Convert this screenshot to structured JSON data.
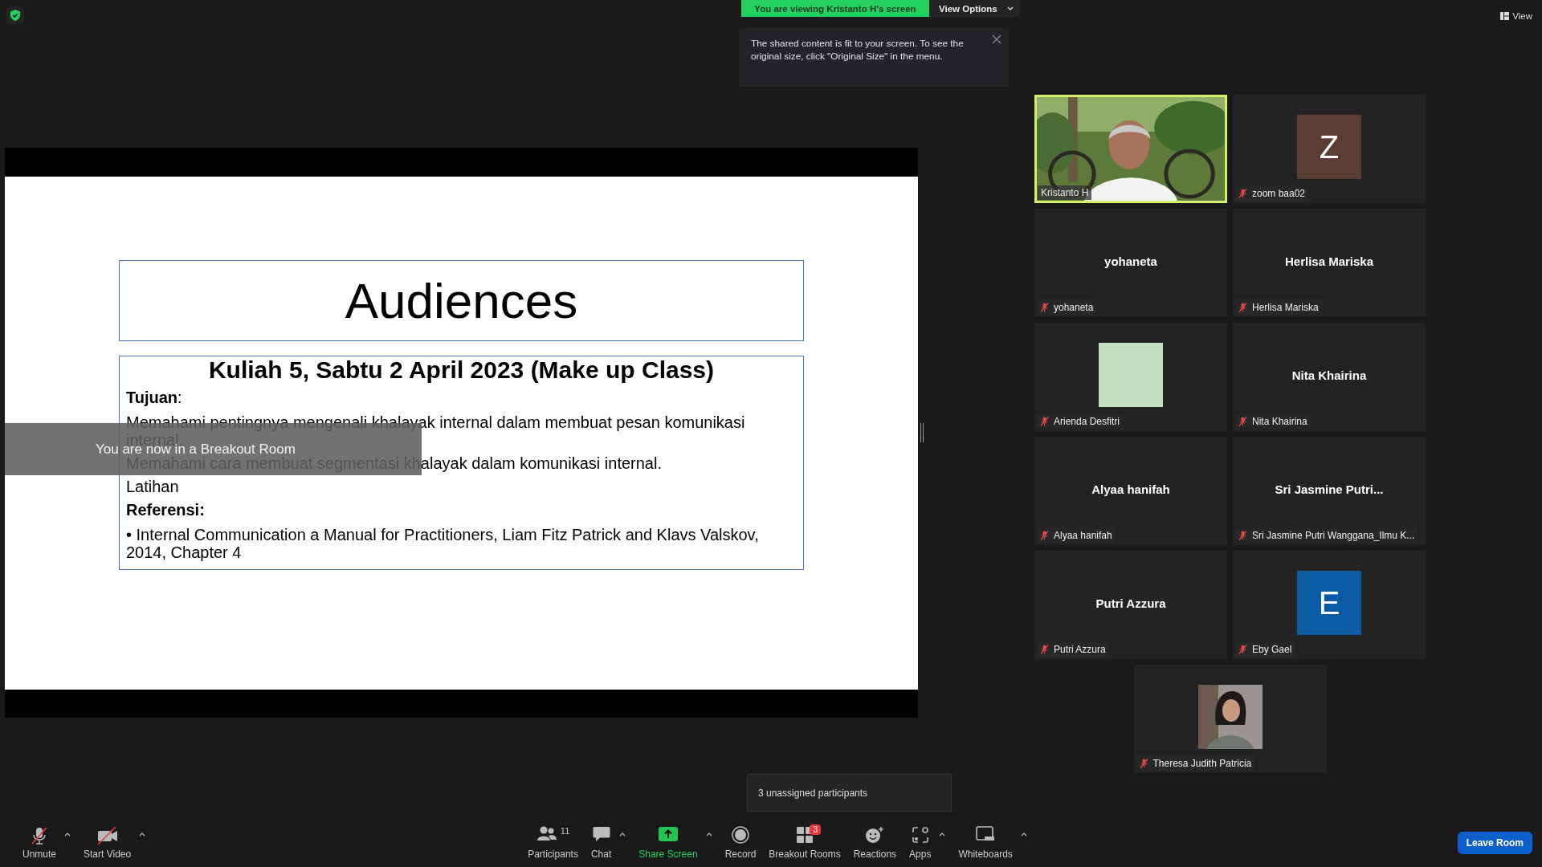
{
  "share_banner": {
    "text": "You are viewing Kristanto H's screen",
    "view_options": "View Options"
  },
  "tooltip": {
    "text": "The shared content is fit to your screen. To see the original size, click \"Original Size\" in the menu."
  },
  "view_button": "View",
  "slide": {
    "title": "Audiences",
    "heading": "Kuliah 5, Sabtu 2 April 2023 (Make up Class)",
    "lines": [
      {
        "kind": "label",
        "text": "**Tujuan**:"
      },
      {
        "kind": "text",
        "text": "Memahami pentingnya mengenali khalayak internal dalam membuat pesan komunikasi internal."
      },
      {
        "kind": "text",
        "text": "Memahami cara membuat segmentasi khalayak dalam komunikasi internal."
      },
      {
        "kind": "text",
        "text": "Latihan"
      },
      {
        "kind": "label",
        "text": "**Referensi:**"
      },
      {
        "kind": "text",
        "text": "• Internal Communication a Manual for Practitioners, Liam Fitz Patrick and Klavs   Valskov, 2014, Chapter 4"
      }
    ]
  },
  "breakout_notice": "You are now in a Breakout Room",
  "tiles": [
    {
      "kind": "video",
      "name": "Kristanto H",
      "muted": false,
      "active_speaker": true
    },
    {
      "kind": "avatar",
      "initial": "Z",
      "color": "#5b3d33",
      "name": "zoom baa02",
      "muted": true,
      "active_speaker": false
    },
    {
      "kind": "name",
      "display": "yohaneta",
      "name": "yohaneta",
      "muted": true,
      "active_speaker": false
    },
    {
      "kind": "name",
      "display": "Herlisa Mariska",
      "name": "Herlisa Mariska",
      "muted": true,
      "active_speaker": false
    },
    {
      "kind": "avatar",
      "color": "#c1e1c1",
      "name": "Arienda Desfitri",
      "muted": true,
      "active_speaker": false
    },
    {
      "kind": "name",
      "display": "Nita Khairina",
      "name": "Nita Khairina",
      "muted": true,
      "active_speaker": false
    },
    {
      "kind": "name",
      "display": "Alyaa hanifah",
      "name": "Alyaa hanifah",
      "muted": true,
      "active_speaker": false
    },
    {
      "kind": "name",
      "display": "Sri Jasmine Putri...",
      "name": "Sri Jasmine Putri Wanggana_Ilmu K...",
      "muted": true,
      "active_speaker": false
    },
    {
      "kind": "name",
      "display": "Putri Azzura",
      "name": "Putri Azzura",
      "muted": true,
      "active_speaker": false
    },
    {
      "kind": "avatar",
      "initial": "E",
      "color": "#0b5aa6",
      "name": "Eby Gael",
      "muted": true,
      "active_speaker": false
    },
    {
      "name": "Theresa Judith Patricia",
      "muted": true,
      "active_speaker": false
    }
  ],
  "unassigned_popup": "3 unassigned participants",
  "toolbar_left": [
    {
      "kind": "unmute",
      "label": "Unmute",
      "has_menu": true
    },
    {
      "kind": "video",
      "label": "Start Video",
      "has_menu": true
    }
  ],
  "toolbar_center": [
    {
      "kind": "participants",
      "label": "Participants",
      "count": "11",
      "has_menu": false,
      "highlighted": false
    },
    {
      "kind": "chat",
      "label": "Chat",
      "has_menu": true,
      "highlighted": false
    },
    {
      "kind": "share",
      "label": "Share Screen",
      "has_menu": true,
      "highlighted": true
    },
    {
      "kind": "record",
      "label": "Record",
      "has_menu": false,
      "highlighted": false
    },
    {
      "kind": "breakout",
      "label": "Breakout Rooms",
      "badge": "3",
      "has_menu": false,
      "highlighted": false
    },
    {
      "kind": "reactions",
      "label": "Reactions",
      "has_menu": false,
      "highlighted": false
    },
    {
      "kind": "apps",
      "label": "Apps",
      "has_menu": true,
      "highlighted": false
    },
    {
      "kind": "whiteboards",
      "label": "Whiteboards",
      "has_menu": true,
      "highlighted": false
    }
  ],
  "leave_button": "Leave Room"
}
